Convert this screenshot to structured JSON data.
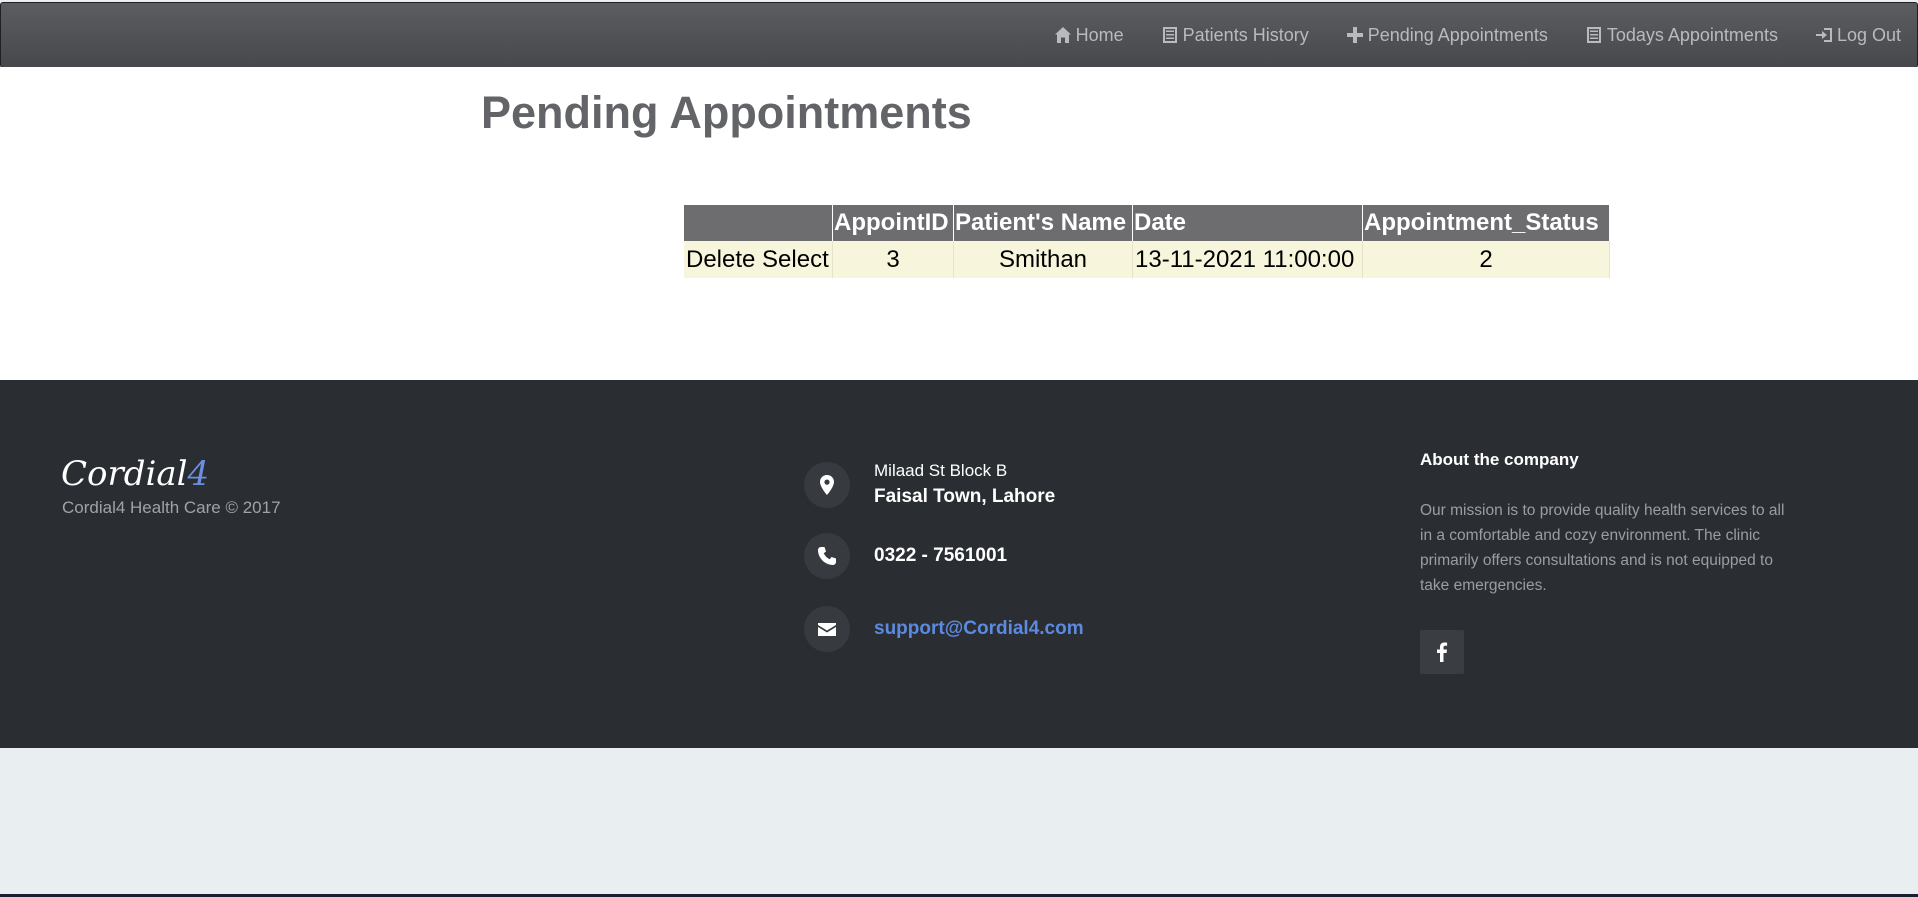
{
  "nav": {
    "items": [
      {
        "label": "Home",
        "icon": "home-icon"
      },
      {
        "label": "Patients History",
        "icon": "list-icon"
      },
      {
        "label": "Pending Appointments",
        "icon": "plus-icon"
      },
      {
        "label": "Todays Appointments",
        "icon": "list-icon"
      },
      {
        "label": "Log Out",
        "icon": "logout-icon"
      }
    ]
  },
  "page": {
    "title": "Pending Appointments"
  },
  "table": {
    "headers": [
      "",
      "AppointID",
      "Patient's Name",
      "Date",
      "Appointment_Status"
    ],
    "rows": [
      {
        "delete_label": "Delete",
        "select_label": "Select",
        "appoint_id": "3",
        "patient_name": "Smithan",
        "date": "13-11-2021 11:00:00",
        "status": "2"
      }
    ]
  },
  "footer": {
    "logo_main": "Cordial",
    "logo_accent": "4",
    "copyright": "Cordial4 Health Care © 2017",
    "address_line1": "Milaad St Block B",
    "address_line2": "Faisal Town, Lahore",
    "phone": "0322 - 7561001",
    "email": "support@Cordial4.com",
    "about_title": "About the company",
    "about_text": "Our mission is to provide quality health services to all in a comfortable and cozy environment. The clinic primarily offers consultations and is not equipped to take emergencies."
  },
  "colors": {
    "navbar": "#4f5154",
    "table_header": "#6d6c6e",
    "table_row": "#f7f6dd",
    "footer": "#2a2e32",
    "email_link": "#5b8ae0"
  }
}
